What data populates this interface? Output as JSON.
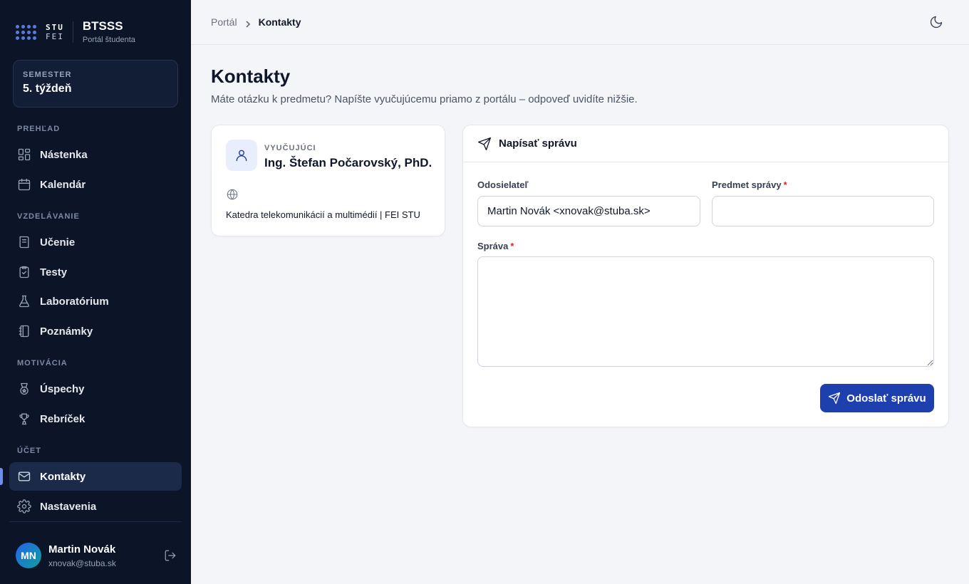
{
  "brand": {
    "logo_top": "STU",
    "logo_bottom": "FEI",
    "title": "BTSSS",
    "subtitle": "Portál študenta"
  },
  "semester": {
    "label": "SEMESTER",
    "value": "5. týždeň"
  },
  "sidebar": {
    "sections": [
      {
        "title": "PREHĽAD",
        "items": [
          {
            "label": "Nástenka",
            "icon": "dashboard-icon"
          },
          {
            "label": "Kalendár",
            "icon": "calendar-icon"
          }
        ]
      },
      {
        "title": "VZDELÁVANIE",
        "items": [
          {
            "label": "Učenie",
            "icon": "book-icon"
          },
          {
            "label": "Testy",
            "icon": "clipboard-check-icon"
          },
          {
            "label": "Laboratórium",
            "icon": "flask-icon"
          },
          {
            "label": "Poznámky",
            "icon": "notebook-icon"
          }
        ]
      },
      {
        "title": "MOTIVÁCIA",
        "items": [
          {
            "label": "Úspechy",
            "icon": "medal-icon"
          },
          {
            "label": "Rebríček",
            "icon": "trophy-icon"
          }
        ]
      },
      {
        "title": "ÚČET",
        "items": [
          {
            "label": "Kontakty",
            "icon": "mail-icon",
            "active": true
          },
          {
            "label": "Nastavenia",
            "icon": "gear-icon"
          }
        ]
      }
    ]
  },
  "user": {
    "initials": "MN",
    "name": "Martin Novák",
    "email": "xnovak@stuba.sk"
  },
  "breadcrumb": {
    "parent": "Portál",
    "current": "Kontakty"
  },
  "page": {
    "title": "Kontakty",
    "description": "Máte otázku k predmetu? Napíšte vyučujúcemu priamo z portálu – odpoveď uvidíte nižšie."
  },
  "teacher": {
    "role": "VYUČUJÚCI",
    "name": "Ing. Štefan Počarovský, PhD.",
    "department": "Katedra telekomunikácií a multimédií | FEI STU"
  },
  "compose": {
    "title": "Napísať správu",
    "sender_label": "Odosielateľ",
    "sender_value": "Martin Novák <xnovak@stuba.sk>",
    "subject_label": "Predmet správy",
    "subject_value": "",
    "message_label": "Správa",
    "message_value": "",
    "required_mark": "*",
    "send_label": "Odoslať správu"
  },
  "colors": {
    "sidebar_bg": "#0c1428",
    "accent": "#1e40af",
    "required": "#dc2626"
  }
}
